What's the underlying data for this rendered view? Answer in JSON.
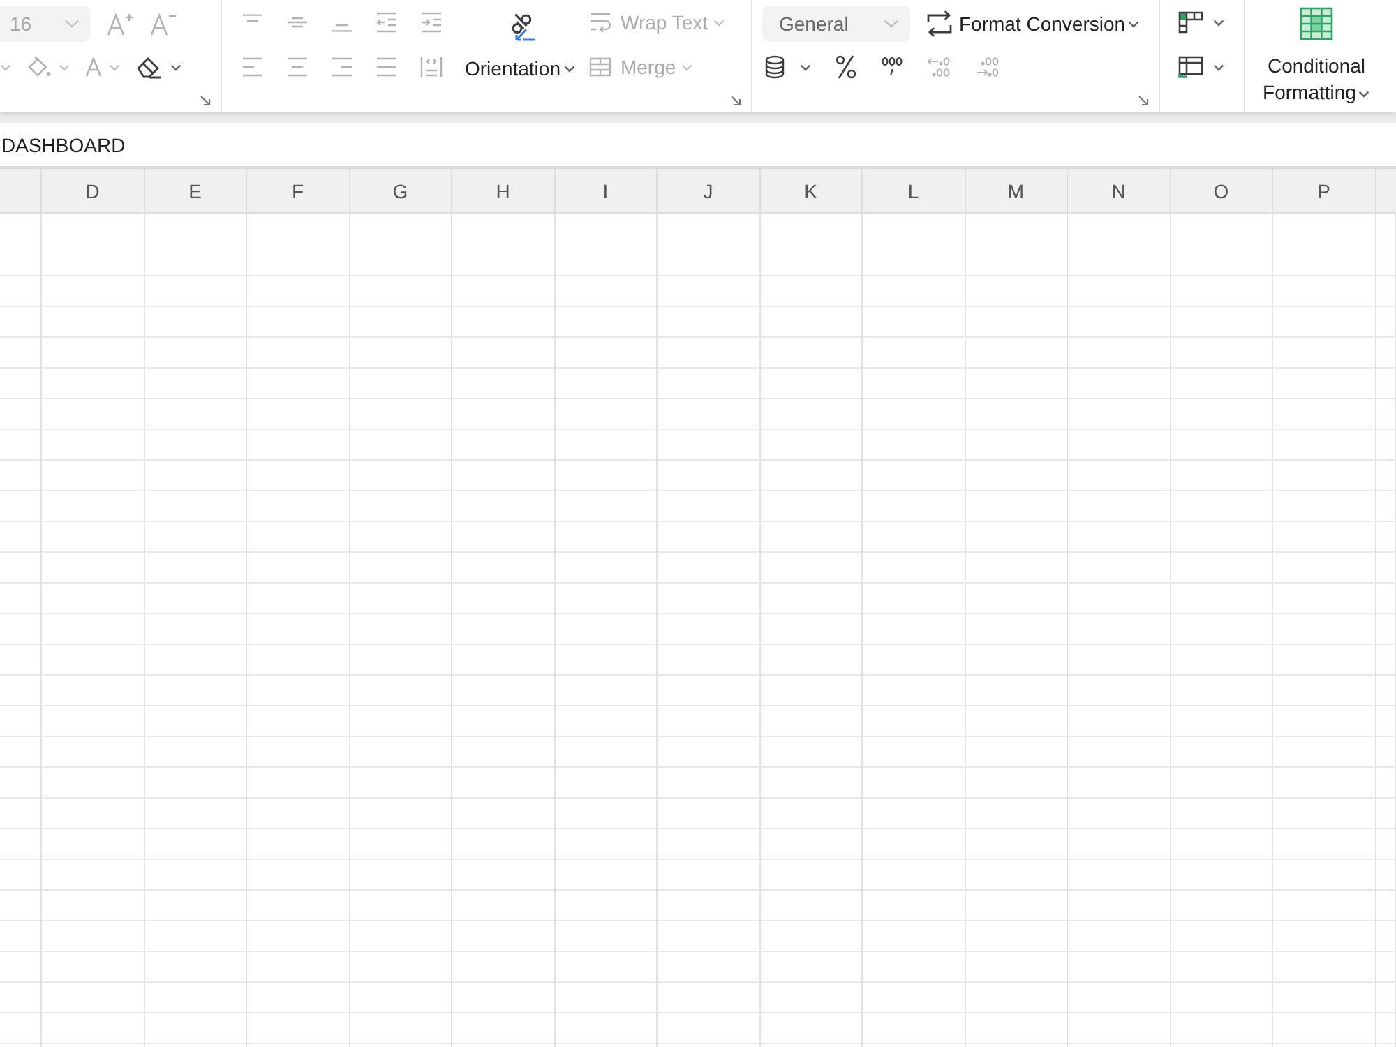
{
  "ribbon": {
    "font": {
      "size_field": {
        "value": "16",
        "disabled": true
      },
      "row_1": [
        {
          "kind": "grow-font",
          "disabled": true,
          "dropdown": false
        },
        {
          "kind": "shrink-font",
          "disabled": true,
          "dropdown": false
        }
      ],
      "row_2": [
        {
          "kind": "cut-off",
          "disabled": true,
          "dropdown": true
        },
        {
          "kind": "fill-color",
          "disabled": true,
          "dropdown": true
        },
        {
          "kind": "font-color",
          "disabled": true,
          "dropdown": true
        },
        {
          "kind": "clear",
          "disabled": false,
          "dropdown": true
        }
      ]
    },
    "alignment": {
      "row_1": [
        {
          "kind": "align-top",
          "disabled": true,
          "dropdown": false
        },
        {
          "kind": "align-middle",
          "disabled": true,
          "dropdown": false
        },
        {
          "kind": "align-bottom",
          "disabled": true,
          "dropdown": false
        },
        {
          "kind": "outdent",
          "disabled": true,
          "dropdown": false
        },
        {
          "kind": "indent",
          "disabled": true,
          "dropdown": false
        }
      ],
      "row_2": [
        {
          "kind": "align-left",
          "disabled": true,
          "dropdown": false
        },
        {
          "kind": "align-center",
          "disabled": true,
          "dropdown": false
        },
        {
          "kind": "align-right",
          "disabled": true,
          "dropdown": false
        },
        {
          "kind": "justify",
          "disabled": true,
          "dropdown": false
        },
        {
          "kind": "distributed",
          "disabled": true,
          "dropdown": false
        }
      ],
      "orientation": {
        "kind": "orientation",
        "label": "Orientation",
        "disabled": false,
        "dropdown": true
      },
      "side": [
        {
          "kind": "wrap-text",
          "label": "Wrap Text",
          "disabled": true,
          "dropdown": true
        },
        {
          "kind": "merge",
          "label": "Merge",
          "disabled": true,
          "dropdown": true
        }
      ]
    },
    "number": {
      "format_field": {
        "value": "General",
        "disabled": false
      },
      "conversion": {
        "kind": "format-conversion",
        "label": "Format Conversion",
        "disabled": false,
        "dropdown": true
      },
      "row_2": [
        {
          "kind": "currency",
          "disabled": false,
          "dropdown": true
        },
        {
          "kind": "percent",
          "disabled": false,
          "dropdown": false
        },
        {
          "kind": "thousands",
          "disabled": false,
          "dropdown": false
        },
        {
          "kind": "decrease-decimal",
          "disabled": true,
          "dropdown": false
        },
        {
          "kind": "increase-decimal",
          "disabled": true,
          "dropdown": false
        }
      ]
    },
    "styles": {
      "tools": [
        {
          "kind": "cell-style",
          "disabled": false,
          "dropdown": true
        },
        {
          "kind": "table-style",
          "disabled": false,
          "dropdown": true
        }
      ]
    },
    "conditional_formatting": {
      "kind": "conditional-formatting",
      "label": "Conditional Formatting",
      "disabled": false,
      "dropdown": true
    }
  },
  "formula_bar": {
    "value": "DASHBOARD"
  },
  "sheet": {
    "columns": [
      "D",
      "E",
      "F",
      "G",
      "H",
      "I",
      "J",
      "K",
      "L",
      "M",
      "N",
      "O",
      "P"
    ]
  }
}
